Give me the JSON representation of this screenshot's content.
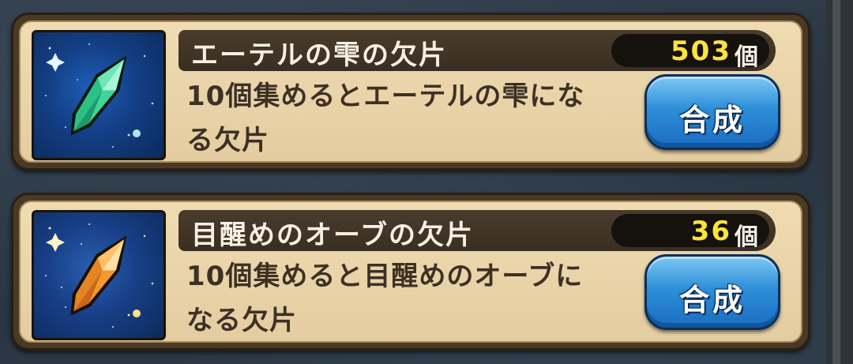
{
  "items": [
    {
      "name": "エーテルの雫の欠片",
      "count": "503",
      "unit": "個",
      "desc_line1": "10個集めるとエーテルの雫にな",
      "desc_line2": "る欠片",
      "button_label": "合成",
      "crystal_color": "#3fd59a",
      "icon": "green-crystal-icon"
    },
    {
      "name": "目醒めのオーブの欠片",
      "count": "36",
      "unit": "個",
      "desc_line1": "10個集めると目醒めのオーブに",
      "desc_line2": "なる欠片",
      "button_label": "合成",
      "crystal_color": "#f39a2e",
      "icon": "orange-crystal-icon"
    }
  ],
  "colors": {
    "count_highlight": "#ffe33a",
    "button_blue": "#2e8fd8",
    "card_beige": "#e8d3a8"
  }
}
